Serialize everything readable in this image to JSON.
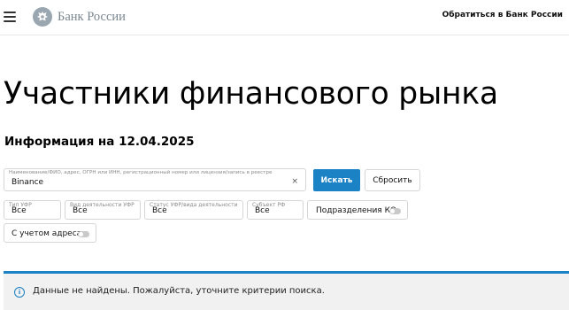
{
  "header": {
    "logo_text": "Банк России",
    "contact_link": "Обратиться в Банк России"
  },
  "page": {
    "title": "Участники финансового рынка",
    "info_date": "Информация на 12.04.2025"
  },
  "filters": {
    "search": {
      "label": "Наименование/ФИО, адрес, ОГРН или ИНН, регистрационный номер или лицензия/запись в реестре",
      "value": "Binance",
      "clear_symbol": "×"
    },
    "search_button": "Искать",
    "reset_button": "Сбросить",
    "ufr_type": {
      "label": "Тип УФР",
      "value": "Все"
    },
    "ufr_activity": {
      "label": "Вид деятельности УФР",
      "value": "Все"
    },
    "ufr_status": {
      "label": "Статус УФР/вида деятельности",
      "value": "Все"
    },
    "rf_subject": {
      "label": "Субъект РФ",
      "value": "Все"
    },
    "ko_divisions": {
      "label": "Подразделения КО",
      "enabled": false
    },
    "with_address": {
      "label": "С учетом адреса",
      "enabled": false
    }
  },
  "alert": {
    "icon_symbol": "i",
    "message": "Данные не найдены. Пожалуйста, уточните критерии поиска."
  },
  "colors": {
    "accent": "#1b82c5",
    "alert_bg": "#f1f1f1",
    "logo_gray": "#9aa7b1"
  }
}
